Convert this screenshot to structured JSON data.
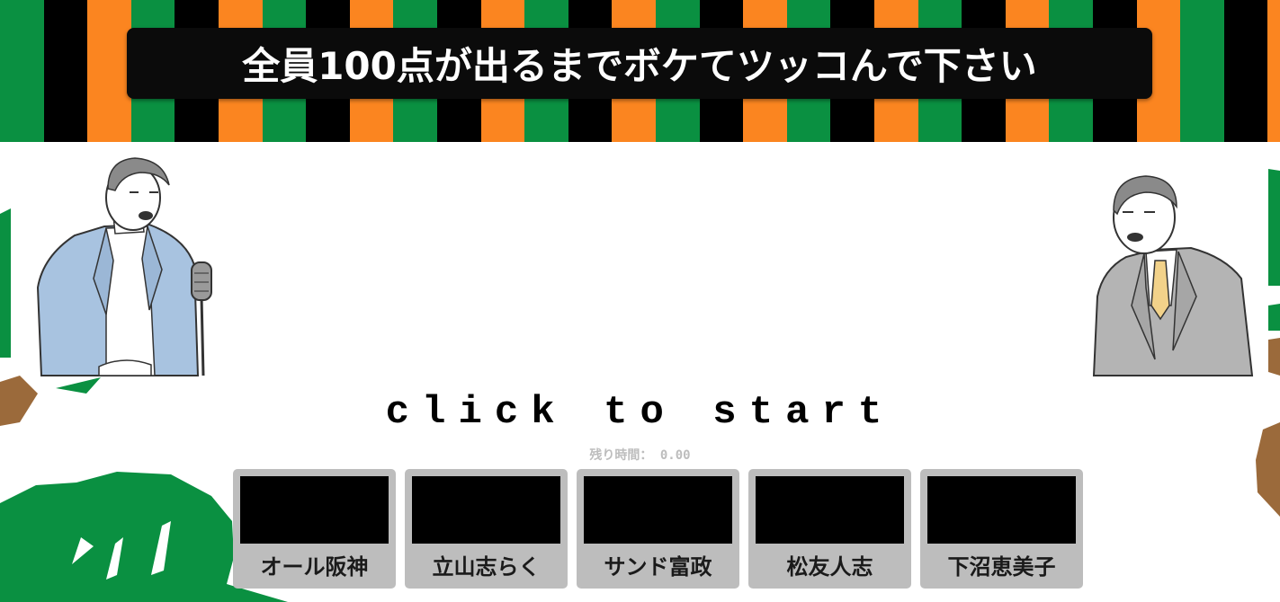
{
  "title": "全員100点が出るまでボケてツッコんで下さい",
  "start_label": "click to start",
  "timer": {
    "label": "残り時間：",
    "value": "0.00"
  },
  "judges": [
    {
      "name": "オール阪神"
    },
    {
      "name": "立山志らく"
    },
    {
      "name": "サンド富政"
    },
    {
      "name": "松友人志"
    },
    {
      "name": "下沼恵美子"
    }
  ],
  "colors": {
    "stripe_pattern": [
      "#0a9041",
      "#000000",
      "#fb8520",
      "#0a9041",
      "#000000",
      "#fb8520"
    ],
    "title_bg": "#0b0b0b",
    "judge_bg": "#bdbdbd",
    "deco_green": "#0a9041",
    "deco_brown": "#9b6a3b"
  },
  "characters": {
    "left": "comedian-with-microphone",
    "right": "judge-in-suit"
  }
}
